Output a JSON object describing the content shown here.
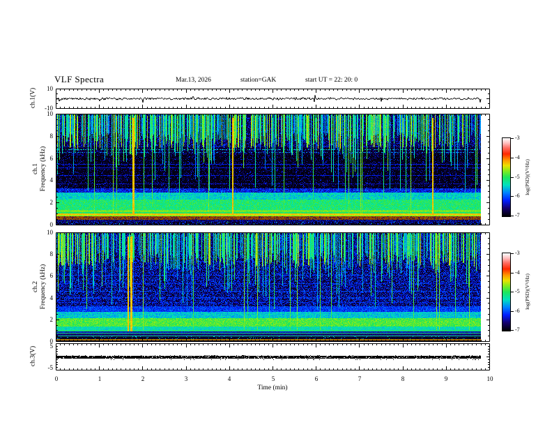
{
  "title": {
    "main": "VLF Spectra",
    "date": "Mar.13, 2026",
    "station": "station=GAK",
    "start_ut": "start UT =  22: 20: 0"
  },
  "chart_data": {
    "type": "heatmap",
    "figure_kind": "vlf-multipanel-spectrogram",
    "xaxis": {
      "label": "Time (min)",
      "min": 0,
      "max": 10,
      "major_tick_values": [
        0,
        1,
        2,
        3,
        4,
        5,
        6,
        7,
        8,
        9,
        10
      ],
      "minor_step": 0.1,
      "data_end_min": 9.8
    },
    "colorbar": {
      "label": "log(PSD)(V²/Hz)",
      "min": -7,
      "max": -3,
      "tick_values": [
        -3,
        -4,
        -5,
        -6,
        -7
      ]
    },
    "colormap": [
      {
        "t": 0.0,
        "c": "#000006"
      },
      {
        "t": 0.1,
        "c": "#14006e"
      },
      {
        "t": 0.2,
        "c": "#001eff"
      },
      {
        "t": 0.3,
        "c": "#0082ff"
      },
      {
        "t": 0.4,
        "c": "#00e1be"
      },
      {
        "t": 0.5,
        "c": "#1ee65a"
      },
      {
        "t": 0.58,
        "c": "#82eb1e"
      },
      {
        "t": 0.65,
        "c": "#ebe100"
      },
      {
        "t": 0.72,
        "c": "#ff9600"
      },
      {
        "t": 0.8,
        "c": "#ff2800"
      },
      {
        "t": 0.88,
        "c": "#ff6e64"
      },
      {
        "t": 0.94,
        "c": "#ffbebe"
      },
      {
        "t": 1.0,
        "c": "#fffcfc"
      }
    ],
    "panels": [
      {
        "id": "ch1-waveform",
        "kind": "line",
        "ylabel": "ch.1(V)",
        "ymin": -10,
        "ymax": 10,
        "ytick_values": [
          10,
          -10
        ],
        "yminor_step": 5,
        "line_color": "#000000",
        "seed": 42,
        "noise_amp_v": 1.1,
        "spike_prob": 0.013,
        "description": "Broadband noise trace about 0 V, ~±2 V, with intermittent downward impulsive spikes to ~-6 V; data ends at 9.8 min"
      },
      {
        "id": "ch1-spectrogram",
        "kind": "heatmap",
        "ylabel_lines": [
          "ch.1",
          "Frequency (kHz)"
        ],
        "ymin": 0,
        "ymax": 10,
        "ytick_values": [
          10,
          8,
          6,
          4,
          2,
          0
        ],
        "yminor_step": 0.5,
        "seed": 7,
        "bands": [
          {
            "f": [
              7,
              10
            ],
            "base": -6.75,
            "noise": 0.25,
            "speckle": [
              0.25,
              -6.2
            ]
          },
          {
            "f": [
              6.3,
              7
            ],
            "base": -6.85,
            "noise": 0.15,
            "speckle": [
              0.15,
              -6.35
            ]
          },
          {
            "f": [
              3.3,
              6.3
            ],
            "base": -6.93,
            "noise": 0.08,
            "speckle": [
              0.13,
              -6.35
            ]
          },
          {
            "f": [
              2.9,
              3.3
            ],
            "base": -6.35,
            "noise": 0.3,
            "speckle": [
              0.3,
              -6.0
            ]
          },
          {
            "f": [
              2.3,
              2.9
            ],
            "base": -5.45,
            "noise": 0.3
          },
          {
            "f": [
              1.3,
              2.3
            ],
            "base": -5.1,
            "noise": 0.3
          },
          {
            "f": [
              1.15,
              1.3
            ],
            "base": -4.75,
            "noise": 0.15
          },
          {
            "f": [
              1.0,
              1.15
            ],
            "base": -5.05,
            "noise": 0.2
          },
          {
            "f": [
              0.86,
              1.0
            ],
            "base": -4.3,
            "noise": 0.12
          },
          {
            "f": [
              0.78,
              0.86
            ],
            "base": -4.6,
            "noise": 0.12
          },
          {
            "f": [
              0.45,
              0.78
            ],
            "base": -4.05,
            "noise": 0.12,
            "dark": 0.58,
            "purple_p": 0.22,
            "speckle2": [
              0.06,
              -5.0
            ]
          },
          {
            "f": [
              0.28,
              0.45
            ],
            "base": -6.6,
            "noise": 0.2,
            "dark": 0.85,
            "speckle": [
              0.2,
              -6.1
            ]
          },
          {
            "f": [
              0,
              0.28
            ],
            "base": -6.85,
            "noise": 0.15,
            "speckle": [
              0.3,
              -6.15
            ],
            "speckle2": [
              0.02,
              -5.1
            ]
          }
        ],
        "hlines": [
          {
            "f": 6.8,
            "v": -5.5,
            "p": 0.55
          },
          {
            "f": 6.55,
            "v": -5.7,
            "p": 0.45
          },
          {
            "f": 5.5,
            "v": -6.25,
            "p": 0.8
          },
          {
            "f": 5.15,
            "v": -6.3,
            "p": 0.8
          },
          {
            "f": 4.45,
            "v": -6.25,
            "p": 0.75
          },
          {
            "f": 3.7,
            "v": -6.35,
            "p": 0.7
          },
          {
            "f": 2.0,
            "v": -4.95,
            "p": 0.22
          },
          {
            "f": 1.65,
            "v": -4.95,
            "p": 0.18
          }
        ],
        "streaks": {
          "top_p": 0.55,
          "tall_p": 0.2,
          "super_p": 0.03,
          "orange_times": [
            1.78,
            4.07,
            8.68
          ]
        },
        "description": "Dense vertical sferic streaks above ~6.3 kHz; quiet dark band 3.3-6.3 kHz with faint horizontal lines; strong green hiss band 1-3 kHz; orange narrowband line near 0.9 kHz; dark-red/maroon band 0.45-0.78 kHz"
      },
      {
        "id": "ch2-spectrogram",
        "kind": "heatmap",
        "ylabel_lines": [
          "ch.2",
          "Frequency (kHz)"
        ],
        "ymin": 0,
        "ymax": 10,
        "ytick_values": [
          10,
          8,
          6,
          4,
          2,
          0
        ],
        "yminor_step": 0.5,
        "seed": 19,
        "bands": [
          {
            "f": [
              8.2,
              10
            ],
            "base": -6.7,
            "noise": 0.2,
            "speckle": [
              0.35,
              -6.1
            ]
          },
          {
            "f": [
              3.2,
              8.2
            ],
            "base": -6.8,
            "noise": 0.15,
            "speckle": [
              0.45,
              -6.15
            ]
          },
          {
            "f": [
              2.7,
              3.2
            ],
            "base": -6.1,
            "noise": 0.3
          },
          {
            "f": [
              2.1,
              2.7
            ],
            "base": -5.5,
            "noise": 0.3
          },
          {
            "f": [
              1.35,
              2.1
            ],
            "base": -4.85,
            "noise": 0.25
          },
          {
            "f": [
              1.0,
              1.35
            ],
            "base": -5.35,
            "noise": 0.25
          },
          {
            "f": [
              0.92,
              1.0
            ],
            "base": -5.1,
            "noise": 0.15
          },
          {
            "f": [
              0.78,
              0.92
            ],
            "base": -6.4,
            "noise": 0.15
          },
          {
            "f": [
              0.7,
              0.78
            ],
            "base": -5.15,
            "noise": 0.12
          },
          {
            "f": [
              0.52,
              0.7
            ],
            "base": -6.6,
            "noise": 0.15
          },
          {
            "f": [
              0.46,
              0.52
            ],
            "base": -5.3,
            "noise": 0.12
          },
          {
            "f": [
              0.18,
              0.46
            ],
            "base": -6.85,
            "noise": 0.1,
            "speckle": [
              0.06,
              -5.6
            ]
          },
          {
            "f": [
              0.08,
              0.18
            ],
            "base": -4.2,
            "noise": 0.08,
            "dark": 0.7
          },
          {
            "f": [
              0,
              0.08
            ],
            "base": -6.9,
            "noise": 0.1
          }
        ],
        "hlines": [
          {
            "f": 7.3,
            "v": -6.2,
            "p": 0.4
          },
          {
            "f": 6.1,
            "v": -6.1,
            "p": 0.7
          },
          {
            "f": 5.3,
            "v": -6.15,
            "p": 0.6
          },
          {
            "f": 4.6,
            "v": -6.05,
            "p": 0.7
          },
          {
            "f": 4.0,
            "v": -6.1,
            "p": 0.6
          },
          {
            "f": 3.6,
            "v": -6.15,
            "p": 0.6
          }
        ],
        "streaks": {
          "top_p": 0.5,
          "tall_p": 0.22,
          "super_p": 0.02,
          "orange_times": [
            1.66,
            1.73
          ]
        },
        "description": "Bluer speckled background 3-8 kHz with sferic streaks; yellow-green hiss core 1.4-2.1 kHz; narrow green lines near 0.5, 0.74 and 0.96 kHz; dark-red line near 0.13 kHz; orange streak cluster near 1.7 min"
      },
      {
        "id": "ch3-waveform",
        "kind": "flatline",
        "ylabel": "ch.3(V)",
        "ymin": -5,
        "ymax": 5,
        "ytick_values": [
          5,
          -5
        ],
        "yminor_step": 1,
        "value_v": 0,
        "line_color": "#000000",
        "seed": 77,
        "description": "Flat thick stippled black trace at 0 V from 0 to 9.8 min"
      }
    ]
  }
}
